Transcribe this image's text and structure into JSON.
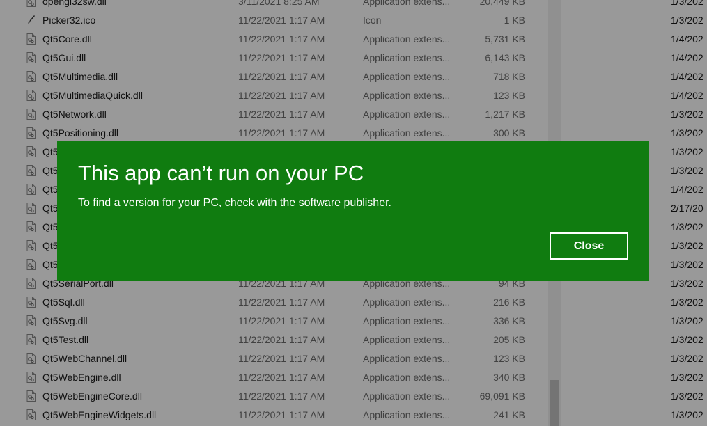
{
  "files": [
    {
      "name": "opengl32sw.dll",
      "date": "3/11/2021 8:25 AM",
      "type": "Application extens...",
      "size": "20,449 KB",
      "icon": "dll-file-icon"
    },
    {
      "name": "Picker32.ico",
      "date": "11/22/2021 1:17 AM",
      "type": "Icon",
      "size": "1 KB",
      "icon": "picker-file-icon"
    },
    {
      "name": "Qt5Core.dll",
      "date": "11/22/2021 1:17 AM",
      "type": "Application extens...",
      "size": "5,731 KB",
      "icon": "dll-file-icon"
    },
    {
      "name": "Qt5Gui.dll",
      "date": "11/22/2021 1:17 AM",
      "type": "Application extens...",
      "size": "6,143 KB",
      "icon": "dll-file-icon"
    },
    {
      "name": "Qt5Multimedia.dll",
      "date": "11/22/2021 1:17 AM",
      "type": "Application extens...",
      "size": "718 KB",
      "icon": "dll-file-icon"
    },
    {
      "name": "Qt5MultimediaQuick.dll",
      "date": "11/22/2021 1:17 AM",
      "type": "Application extens...",
      "size": "123 KB",
      "icon": "dll-file-icon"
    },
    {
      "name": "Qt5Network.dll",
      "date": "11/22/2021 1:17 AM",
      "type": "Application extens...",
      "size": "1,217 KB",
      "icon": "dll-file-icon"
    },
    {
      "name": "Qt5Positioning.dll",
      "date": "11/22/2021 1:17 AM",
      "type": "Application extens...",
      "size": "300 KB",
      "icon": "dll-file-icon"
    },
    {
      "name": "Qt5",
      "date": "",
      "type": "",
      "size": "",
      "icon": "dll-file-icon"
    },
    {
      "name": "Qt5",
      "date": "",
      "type": "",
      "size": "",
      "icon": "dll-file-icon"
    },
    {
      "name": "Qt5",
      "date": "",
      "type": "",
      "size": "",
      "icon": "dll-file-icon"
    },
    {
      "name": "Qt5",
      "date": "",
      "type": "",
      "size": "",
      "icon": "dll-file-icon"
    },
    {
      "name": "Qt5",
      "date": "",
      "type": "",
      "size": "",
      "icon": "dll-file-icon"
    },
    {
      "name": "Qt5",
      "date": "",
      "type": "",
      "size": "",
      "icon": "dll-file-icon"
    },
    {
      "name": "Qt5",
      "date": "",
      "type": "",
      "size": "",
      "icon": "dll-file-icon"
    },
    {
      "name": "Qt5SerialPort.dll",
      "date": "11/22/2021 1:17 AM",
      "type": "Application extens...",
      "size": "94 KB",
      "icon": "dll-file-icon"
    },
    {
      "name": "Qt5Sql.dll",
      "date": "11/22/2021 1:17 AM",
      "type": "Application extens...",
      "size": "216 KB",
      "icon": "dll-file-icon"
    },
    {
      "name": "Qt5Svg.dll",
      "date": "11/22/2021 1:17 AM",
      "type": "Application extens...",
      "size": "336 KB",
      "icon": "dll-file-icon"
    },
    {
      "name": "Qt5Test.dll",
      "date": "11/22/2021 1:17 AM",
      "type": "Application extens...",
      "size": "205 KB",
      "icon": "dll-file-icon"
    },
    {
      "name": "Qt5WebChannel.dll",
      "date": "11/22/2021 1:17 AM",
      "type": "Application extens...",
      "size": "123 KB",
      "icon": "dll-file-icon"
    },
    {
      "name": "Qt5WebEngine.dll",
      "date": "11/22/2021 1:17 AM",
      "type": "Application extens...",
      "size": "340 KB",
      "icon": "dll-file-icon"
    },
    {
      "name": "Qt5WebEngineCore.dll",
      "date": "11/22/2021 1:17 AM",
      "type": "Application extens...",
      "size": "69,091 KB",
      "icon": "dll-file-icon"
    },
    {
      "name": "Qt5WebEngineWidgets.dll",
      "date": "11/22/2021 1:17 AM",
      "type": "Application extens...",
      "size": "241 KB",
      "icon": "dll-file-icon"
    }
  ],
  "second_pane_dates": [
    "1/3/202",
    "1/3/202",
    "1/4/202",
    "1/4/202",
    "1/4/202",
    "1/4/202",
    "1/3/202",
    "1/3/202",
    "1/3/202",
    "1/3/202",
    "1/4/202",
    "2/17/20",
    "1/3/202",
    "1/3/202",
    "1/3/202",
    "1/3/202",
    "1/3/202",
    "1/3/202",
    "1/3/202",
    "1/3/202",
    "1/3/202",
    "1/3/202",
    "1/3/202"
  ],
  "dialog": {
    "title": "This app can’t run on your PC",
    "message": "To find a version for your PC, check with the software publisher.",
    "close_label": "Close",
    "background_color": "#107c10"
  }
}
